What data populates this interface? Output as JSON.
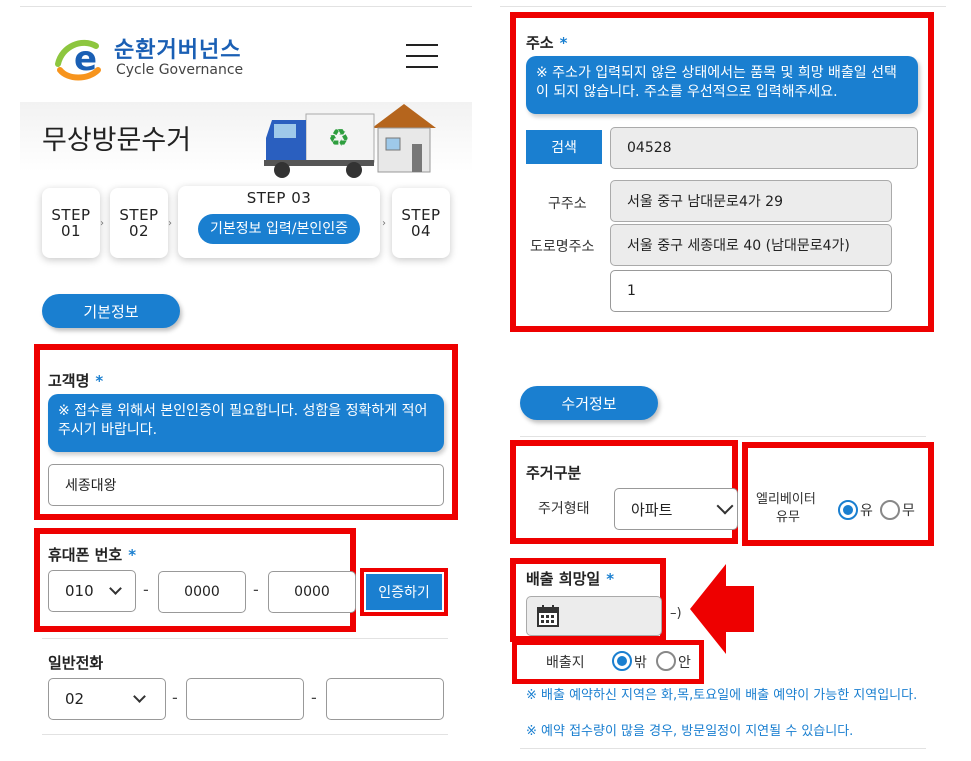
{
  "left": {
    "logo": {
      "korean": "순환거버넌스",
      "english": "Cycle Governance"
    },
    "page_title": "무상방문수거",
    "steps": {
      "step1": [
        "STEP",
        "01"
      ],
      "step2": [
        "STEP",
        "02"
      ],
      "step3_title": "STEP 03",
      "step3_label": "기본정보 입력/본인인증",
      "step4": [
        "STEP",
        "04"
      ]
    },
    "section_basic": "기본정보",
    "customer_name": {
      "label": "고객명",
      "required": "*",
      "notice": "※ 접수를 위해서 본인인증이 필요합니다. 성함을 정확하게 적어주시기 바랍니다.",
      "value": "세종대왕"
    },
    "mobile": {
      "label": "휴대폰 번호",
      "required": "*",
      "prefix": "010",
      "mid": "0000",
      "last": "0000",
      "dash": "-",
      "verify_button": "인증하기"
    },
    "phone": {
      "label": "일반전화",
      "prefix": "02",
      "mid": "",
      "last": "",
      "dash": "-"
    }
  },
  "right": {
    "address": {
      "label": "주소",
      "required": "*",
      "notice": "※ 주소가 입력되지 않은 상태에서는 품목 및 희망 배출일 선택이 되지 않습니다. 주소를 우선적으로 입력해주세요.",
      "search_button": "검색",
      "zipcode": "04528",
      "old_label": "구주소",
      "old_value": "서울 중구 남대문로4가 29",
      "road_label": "도로명주소",
      "road_value": "서울 중구 세종대로 40 (남대문로4가)",
      "detail_value": "1"
    },
    "section_pickup": "수거정보",
    "housing": {
      "label": "주거구분",
      "type_label": "주거형태",
      "type_value": "아파트",
      "elevator_label_1": "엘리베이터",
      "elevator_label_2": "유무",
      "yes": "유",
      "no": "무"
    },
    "date": {
      "label": "배출 희망일",
      "required": "*",
      "suffix": "–)"
    },
    "location": {
      "label": "배출지",
      "outside": "밖",
      "inside": "안"
    },
    "info1": "※ 배출 예약하신 지역은 화,목,토요일에 배출 예약이 가능한 지역입니다.",
    "info2": "※ 예약 접수량이 많을 경우, 방문일정이 지연될 수 있습니다."
  },
  "colors": {
    "accent": "#1a7fd0",
    "highlight": "#ee0000"
  }
}
